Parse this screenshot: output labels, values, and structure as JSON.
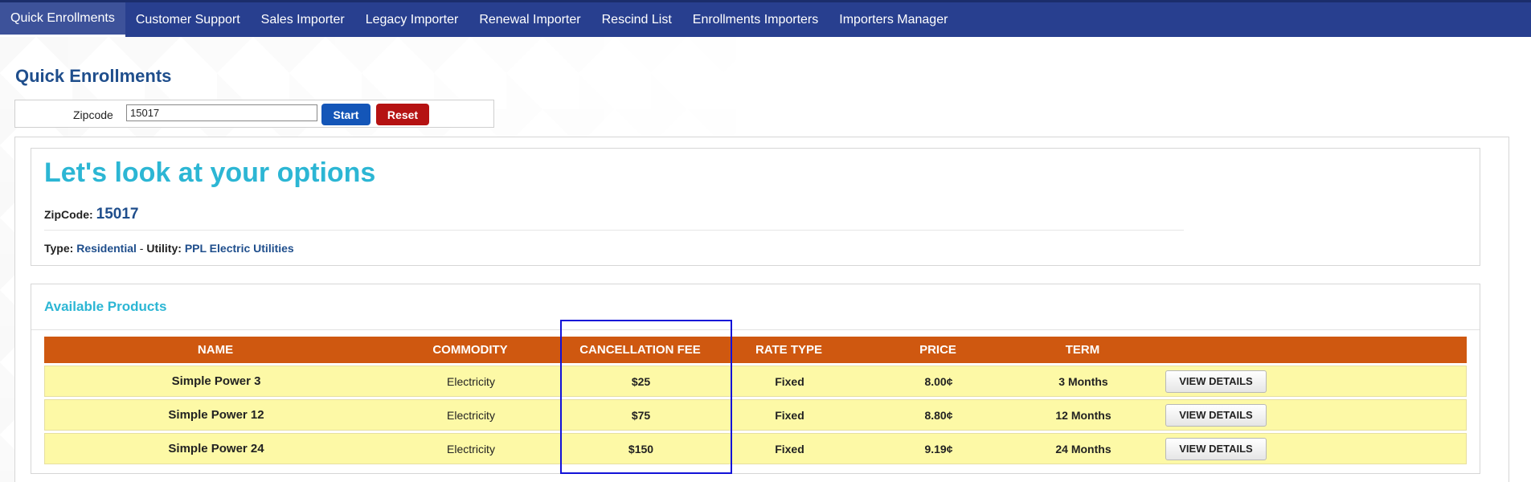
{
  "nav": {
    "items": [
      {
        "label": "Quick Enrollments",
        "active": true
      },
      {
        "label": "Customer Support"
      },
      {
        "label": "Sales Importer"
      },
      {
        "label": "Legacy Importer"
      },
      {
        "label": "Renewal Importer"
      },
      {
        "label": "Rescind List"
      },
      {
        "label": "Enrollments Importers"
      },
      {
        "label": "Importers Manager"
      }
    ]
  },
  "page": {
    "title": "Quick Enrollments"
  },
  "zip_form": {
    "label": "Zipcode",
    "value": "15017",
    "start_label": "Start",
    "reset_label": "Reset"
  },
  "options": {
    "headline": "Let's look at your options",
    "zip_label": "ZipCode:",
    "zip_value": "15017",
    "type_label": "Type:",
    "type_value": "Residential",
    "separator": " - ",
    "utility_label": "Utility:",
    "utility_value": "PPL Electric Utilities"
  },
  "products": {
    "title": "Available Products",
    "columns": [
      "NAME",
      "COMMODITY",
      "CANCELLATION FEE",
      "RATE TYPE",
      "PRICE",
      "TERM",
      ""
    ],
    "rows": [
      {
        "name": "Simple Power 3",
        "commodity": "Electricity",
        "fee": "$25",
        "rate_type": "Fixed",
        "price": "8.00¢",
        "term": "3 Months",
        "action": "VIEW DETAILS"
      },
      {
        "name": "Simple Power 12",
        "commodity": "Electricity",
        "fee": "$75",
        "rate_type": "Fixed",
        "price": "8.80¢",
        "term": "12 Months",
        "action": "VIEW DETAILS"
      },
      {
        "name": "Simple Power 24",
        "commodity": "Electricity",
        "fee": "$150",
        "rate_type": "Fixed",
        "price": "9.19¢",
        "term": "24 Months",
        "action": "VIEW DETAILS"
      }
    ]
  },
  "colors": {
    "nav_bg": "#283f8f",
    "table_header": "#cf5810",
    "row_bg": "#fdf9a6",
    "accent_cyan": "#2cb6d4",
    "highlight": "#1212d8"
  }
}
